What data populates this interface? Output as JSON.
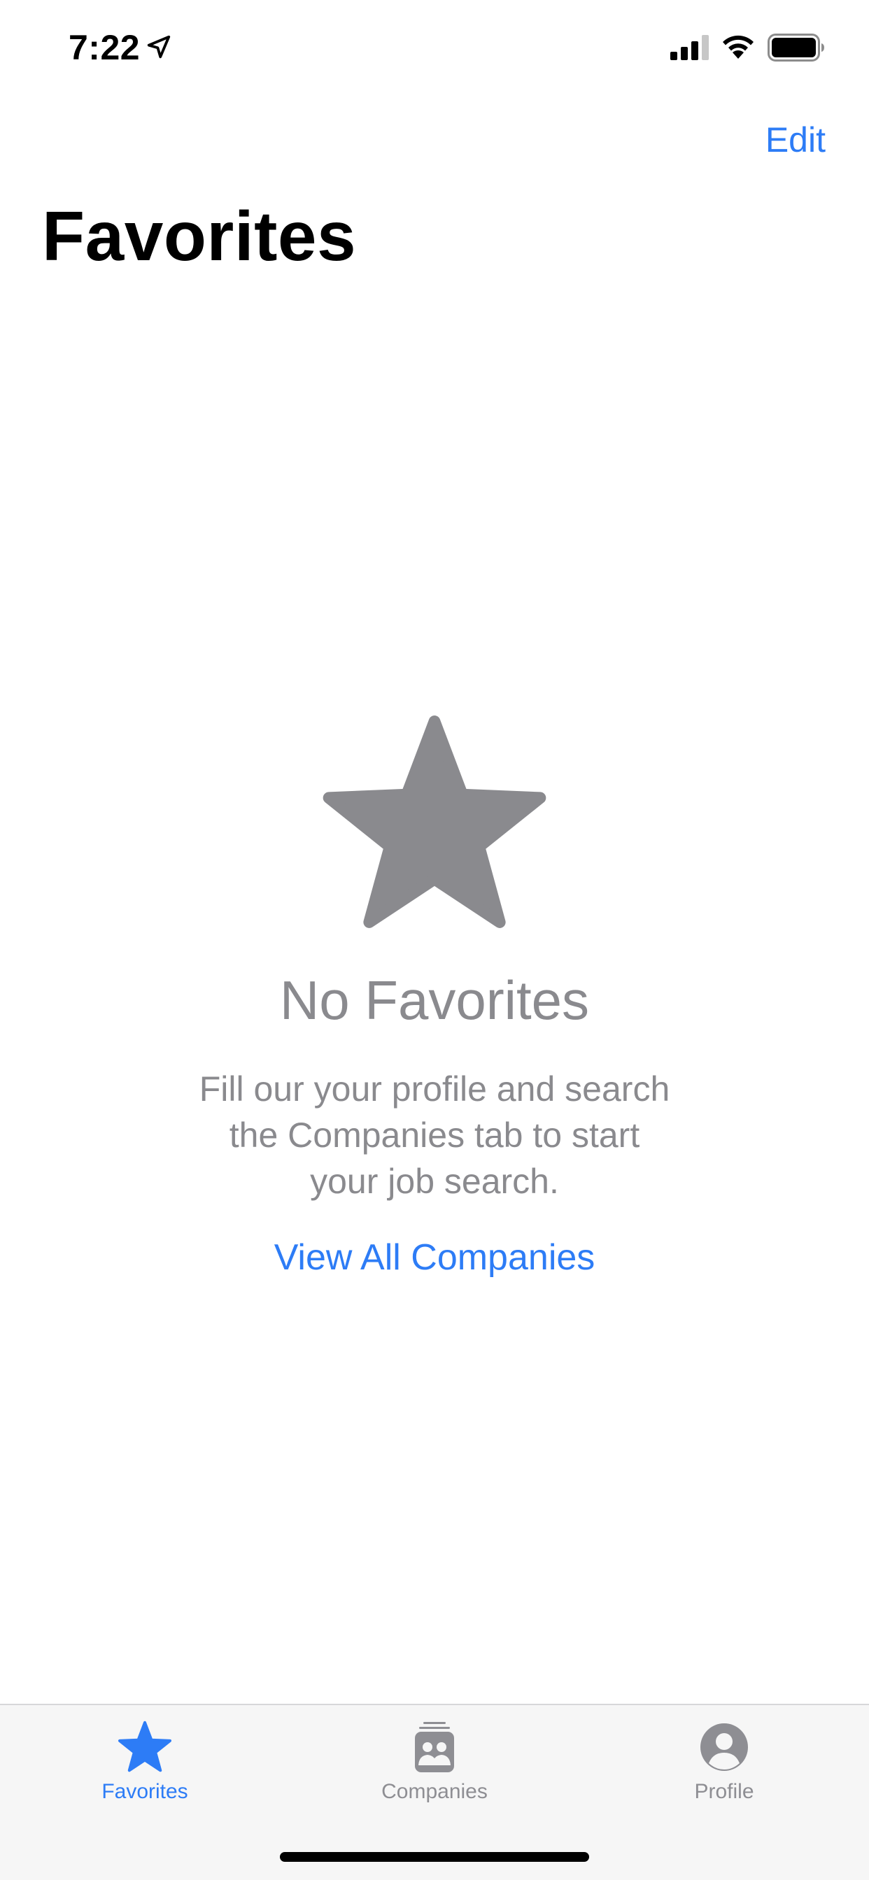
{
  "status_bar": {
    "time": "7:22",
    "icons": [
      "location-arrow-icon",
      "cellular-signal-icon",
      "wifi-icon",
      "battery-icon"
    ]
  },
  "nav": {
    "edit_label": "Edit",
    "title": "Favorites"
  },
  "empty_state": {
    "icon": "star-icon",
    "title": "No Favorites",
    "message_lines": [
      "Fill our your profile and search",
      "the Companies tab to start",
      "your job search."
    ],
    "link_label": "View All Companies"
  },
  "tab_bar": {
    "tabs": [
      {
        "label": "Favorites",
        "icon": "star-icon",
        "selected": true
      },
      {
        "label": "Companies",
        "icon": "companies-icon",
        "selected": false
      },
      {
        "label": "Profile",
        "icon": "person-circle-icon",
        "selected": false
      }
    ]
  },
  "colors": {
    "accent": "#2d7cf6",
    "secondary_text": "#8a8a8e",
    "tab_bar_background": "#f6f6f6"
  }
}
